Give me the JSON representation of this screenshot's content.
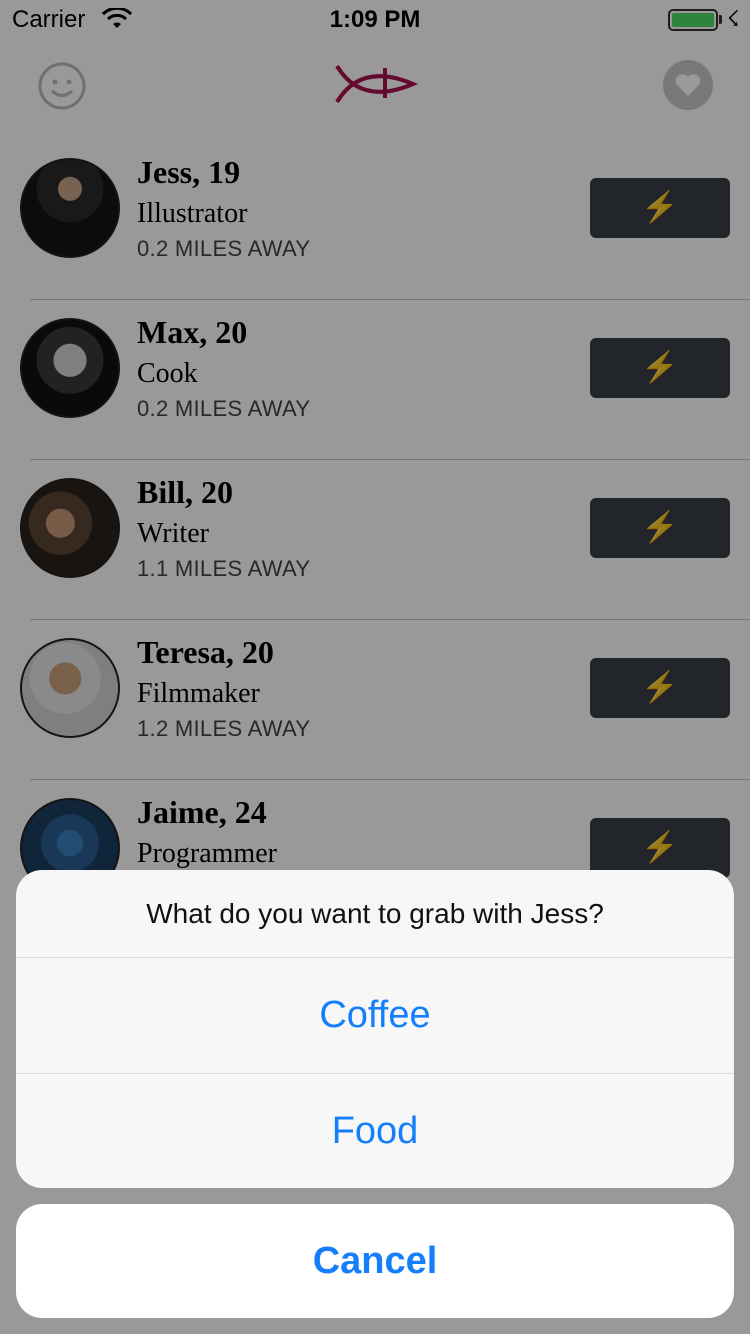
{
  "status_bar": {
    "carrier": "Carrier",
    "time": "1:09 PM",
    "battery_level": 1.0
  },
  "nav": {
    "left_icon": "smiley-icon",
    "center_icon": "fish-logo-icon",
    "right_icon": "heart-icon",
    "logo_color": "#a8124f"
  },
  "people": [
    {
      "name": "Jess, 19",
      "job": "Illustrator",
      "distance": "0.2 MILES AWAY"
    },
    {
      "name": "Max, 20",
      "job": "Cook",
      "distance": "0.2 MILES AWAY"
    },
    {
      "name": "Bill, 20",
      "job": "Writer",
      "distance": "1.1 MILES AWAY"
    },
    {
      "name": "Teresa, 20",
      "job": "Filmmaker",
      "distance": "1.2 MILES AWAY"
    },
    {
      "name": "Jaime, 24",
      "job": "Programmer",
      "distance": ""
    }
  ],
  "action_button_icon": "lightning-icon",
  "action_sheet": {
    "title": "What do you want to grab with Jess?",
    "options": [
      "Coffee",
      "Food"
    ],
    "cancel": "Cancel",
    "accent_color": "#157efb"
  }
}
